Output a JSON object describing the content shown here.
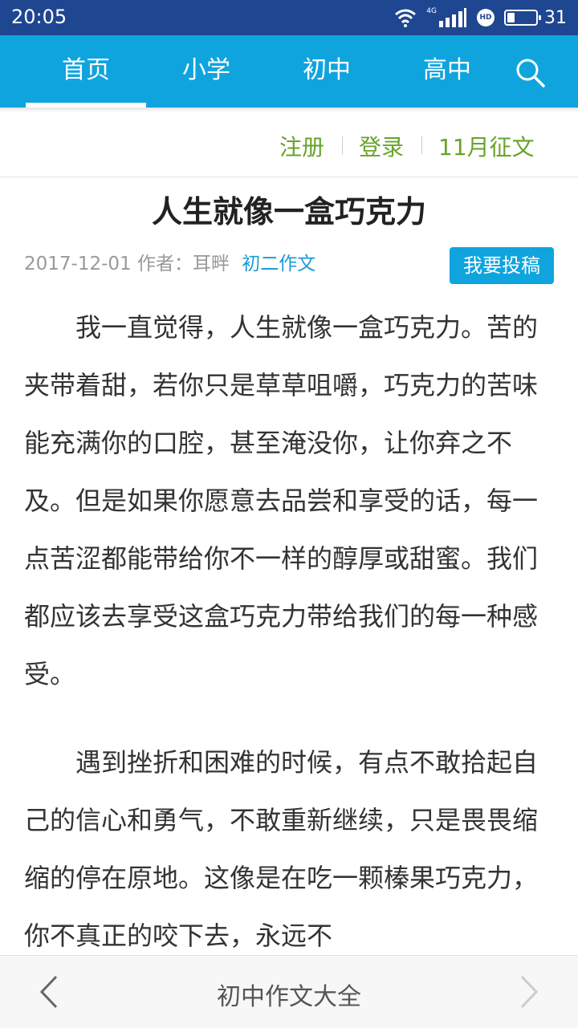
{
  "status_bar": {
    "time": "20:05",
    "network_label": "4G",
    "hd_label": "HD",
    "battery_level": 0.35,
    "battery_text": "31"
  },
  "nav": {
    "tabs": [
      {
        "label": "首页",
        "active": true
      },
      {
        "label": "小学",
        "active": false
      },
      {
        "label": "初中",
        "active": false
      },
      {
        "label": "高中",
        "active": false
      }
    ],
    "search_icon": "search-icon"
  },
  "user_links": {
    "register": "注册",
    "login": "登录",
    "contest": "11月征文"
  },
  "article": {
    "title": "人生就像一盒巧克力",
    "date": "2017-12-01",
    "author_label": "作者：耳畔",
    "category": "初二作文",
    "submit_label": "我要投稿",
    "paragraphs": [
      "我一直觉得，人生就像一盒巧克力。苦的夹带着甜，若你只是草草咀嚼，巧克力的苦味能充满你的口腔，甚至淹没你，让你弃之不及。但是如果你愿意去品尝和享受的话，每一点苦涩都能带给你不一样的醇厚或甜蜜。我们都应该去享受这盒巧克力带给我们的每一种感受。",
      "遇到挫折和困难的时候，有点不敢拾起自己的信心和勇气，不敢重新继续，只是畏畏缩缩的停在原地。这像是在吃一颗榛果巧克力，你不真正的咬下去，永远不"
    ]
  },
  "bottom_bar": {
    "title": "初中作文大全",
    "back_icon": "chevron-left-icon",
    "forward_icon": "chevron-right-icon"
  },
  "colors": {
    "status_bar": "#1f4690",
    "nav_bar": "#0fa4de",
    "link_green": "#67a32a",
    "category_blue": "#1a9bd7"
  }
}
